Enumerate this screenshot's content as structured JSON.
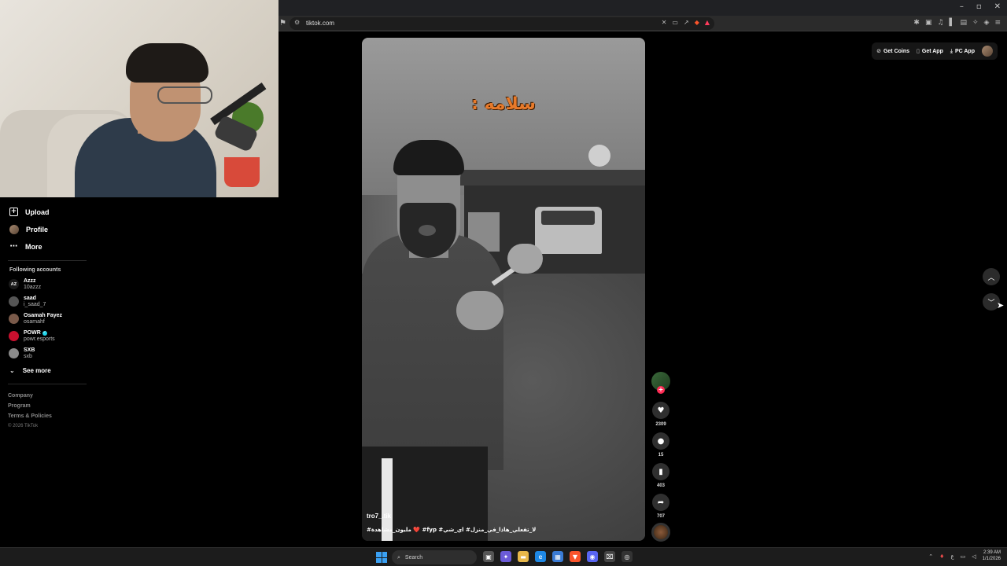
{
  "browser": {
    "url": "tiktok.com",
    "window_controls": {
      "minimize": "–",
      "restore": "▫",
      "close": "✕"
    }
  },
  "sidebar": {
    "nav": [
      {
        "label": "Upload",
        "icon": "plus-square-icon"
      },
      {
        "label": "Profile",
        "icon": "avatar"
      },
      {
        "label": "More",
        "icon": "ellipsis-icon"
      }
    ],
    "following_title": "Following accounts",
    "accounts": [
      {
        "name": "Azzz",
        "handle": "10azzz",
        "avatar_text": "AZ",
        "avatar_color": "#1a1a1a",
        "verified": false
      },
      {
        "name": "saad",
        "handle": "i_saad_7",
        "avatar_text": "",
        "avatar_color": "#555555",
        "verified": false
      },
      {
        "name": "Osamah Fayez",
        "handle": "osamahf",
        "avatar_text": "",
        "avatar_color": "#7a5a4a",
        "verified": false
      },
      {
        "name": "POWR",
        "handle": "powr.esports",
        "avatar_text": "",
        "avatar_color": "#c8102e",
        "verified": true
      },
      {
        "name": "SXB",
        "handle": "sxb",
        "avatar_text": "",
        "avatar_color": "#8a8a8a",
        "verified": false
      }
    ],
    "see_more": "See more",
    "footer": [
      "Company",
      "Program",
      "Terms & Policies"
    ],
    "copyright": "© 2026 TikTok"
  },
  "video": {
    "overlay_text": "سلامه :",
    "username": "tro7_.tik",
    "caption": "لا_تفعلي_هاذا_في_منزل# اي_شي# fyp# ❤️ مليون_مشاهدة#"
  },
  "actions": {
    "likes": "2309",
    "comments": "15",
    "saves": "403",
    "shares": "707"
  },
  "top_right": {
    "get_coins": "Get Coins",
    "get_app": "Get App",
    "pc_app": "PC App"
  },
  "taskbar": {
    "search_placeholder": "Search",
    "time": "2:39 AM",
    "date": "1/1/2026",
    "lang": "ع"
  },
  "colors": {
    "accent": "#fe2c55",
    "overlay_text": "#e87a2a",
    "verified": "#20d5ec"
  }
}
